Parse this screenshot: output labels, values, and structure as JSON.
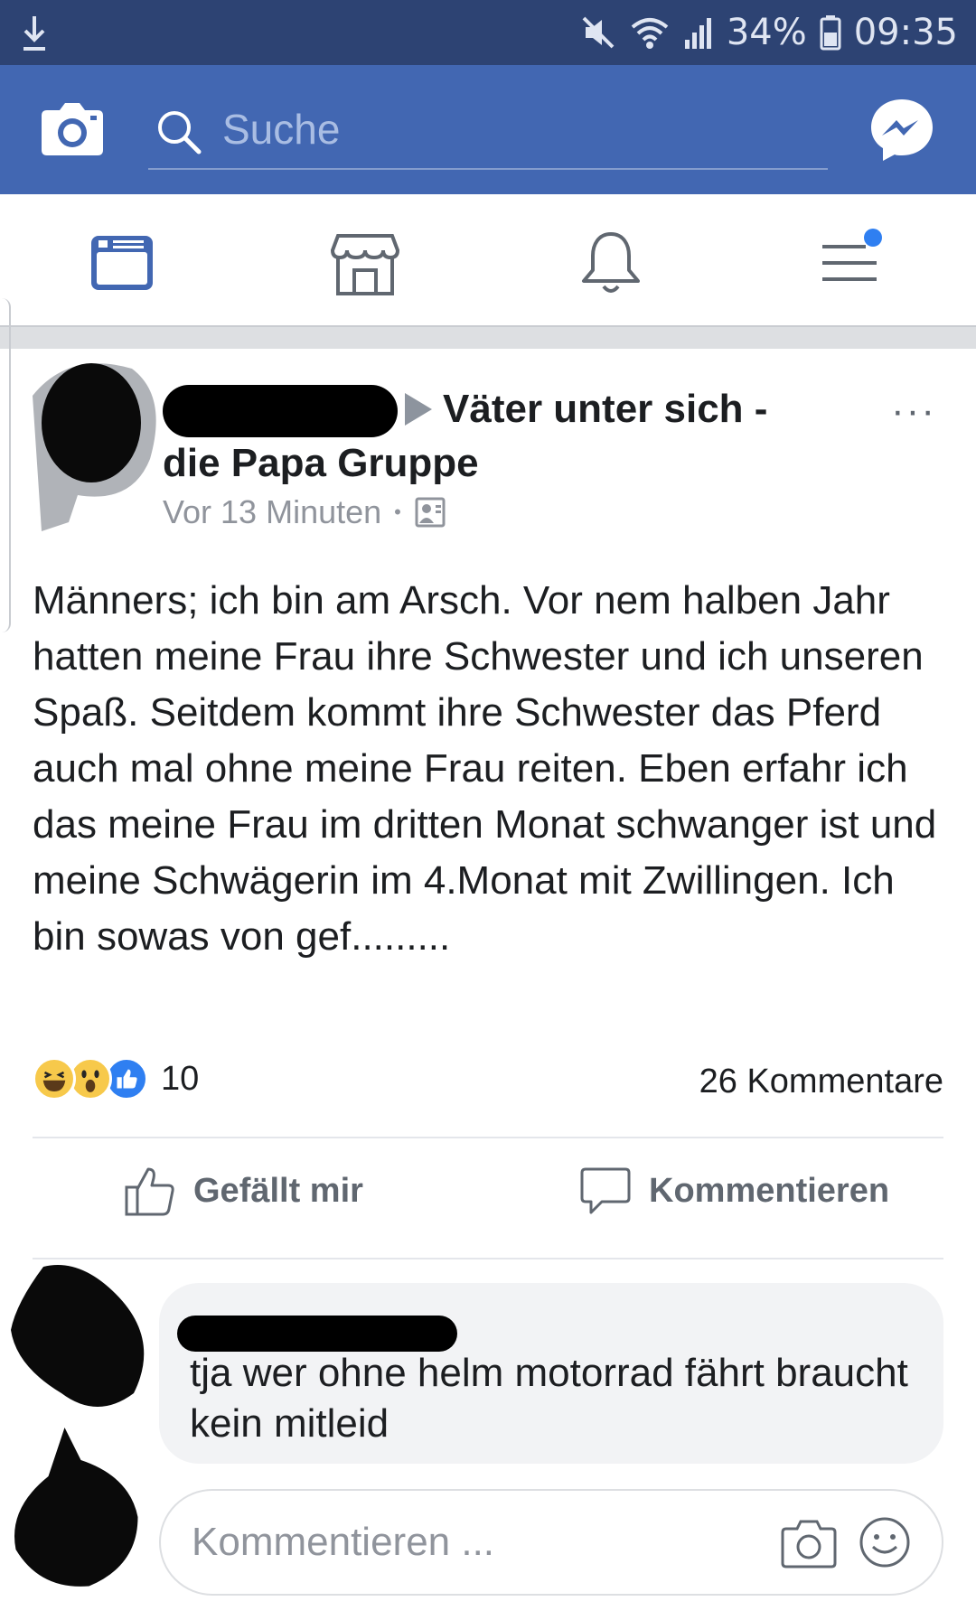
{
  "status_bar": {
    "battery": "34%",
    "time": "09:35",
    "icons": [
      "download-icon",
      "mute-icon",
      "wifi-icon",
      "signal-icon",
      "battery-icon"
    ]
  },
  "app_bar": {
    "search_placeholder": "Suche",
    "icons": [
      "camera-icon",
      "search-icon",
      "messenger-icon"
    ],
    "color": "#4267b2"
  },
  "tab_bar": {
    "tabs": [
      "news-feed-icon",
      "marketplace-icon",
      "notifications-icon",
      "menu-icon"
    ],
    "active_color": "#4267b2"
  },
  "post": {
    "group_name_line1": "Väter unter sich -",
    "group_name_line2": "die Papa Gruppe",
    "timestamp": "Vor 13 Minuten",
    "more": "···",
    "text": "Männers; ich bin am Arsch. Vor nem halben Jahr hatten meine Frau ihre Schwester und ich unseren Spaß. Seitdem kommt ihre Schwester das Pferd auch mal ohne meine Frau reiten. Eben erfahr ich das meine Frau im dritten Monat schwanger ist und meine Schwägerin im 4.Monat mit Zwillingen. Ich bin sowas von gef.........",
    "reaction_count": "10",
    "comment_count": "26 Kommentare",
    "like_label": "Gefällt mir",
    "comment_label": "Kommentieren"
  },
  "comment": {
    "text": "tja wer ohne helm motorrad fährt braucht kein mitleid"
  },
  "composer": {
    "placeholder": "Kommentieren ..."
  }
}
